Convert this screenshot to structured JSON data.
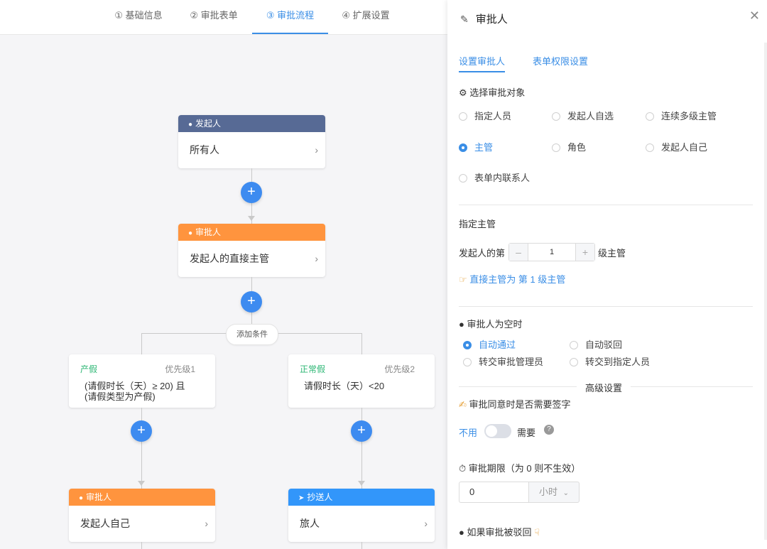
{
  "steps": [
    {
      "label": "① 基础信息"
    },
    {
      "label": "② 审批表单"
    },
    {
      "label": "③ 审批流程"
    },
    {
      "label": "④ 扩展设置"
    }
  ],
  "flow": {
    "initiator": {
      "title": "发起人",
      "text": "所有人"
    },
    "approver": {
      "title": "审批人",
      "text": "发起人的直接主管"
    },
    "add_condition": "添加条件",
    "conditions": [
      {
        "title": "产假",
        "priority": "优先级1",
        "line1": "(请假时长（天）≥ 20) 且",
        "line2": "(请假类型为产假)"
      },
      {
        "title": "正常假",
        "priority": "优先级2",
        "line1": "请假时长（天）<20",
        "line2": ""
      }
    ],
    "branch_left": {
      "title": "审批人",
      "text": "发起人自己"
    },
    "branch_right": {
      "title": "抄送人",
      "text": "旅人"
    }
  },
  "panel": {
    "title": "审批人",
    "tabs": [
      "设置审批人",
      "表单权限设置"
    ],
    "select_label": "⚙ 选择审批对象",
    "options": [
      "指定人员",
      "发起人自选",
      "连续多级主管",
      "主管",
      "角色",
      "发起人自己",
      "表单内联系人"
    ],
    "selected": "主管",
    "manager_section": "指定主管",
    "level_prefix": "发起人的第",
    "level_value": "1",
    "level_suffix": "级主管",
    "level_hint": "直接主管为 第 1 级主管",
    "empty_label": "审批人为空时",
    "empty_options": [
      "自动通过",
      "自动驳回",
      "转交审批管理员",
      "转交到指定人员"
    ],
    "advanced": "高级设置",
    "sign_label": "审批同意时是否需要签字",
    "sign_off": "不用",
    "sign_on": "需要",
    "deadline_label": "审批期限（为 0 则不生效）",
    "deadline_value": "0",
    "deadline_unit": "小时",
    "reject_label": "如果审批被驳回"
  },
  "colors": {
    "accent": "#3a8ee6",
    "initiator": "#576a95",
    "approver": "#ff943e",
    "cc": "#3296fa",
    "condition": "#2bb673"
  }
}
